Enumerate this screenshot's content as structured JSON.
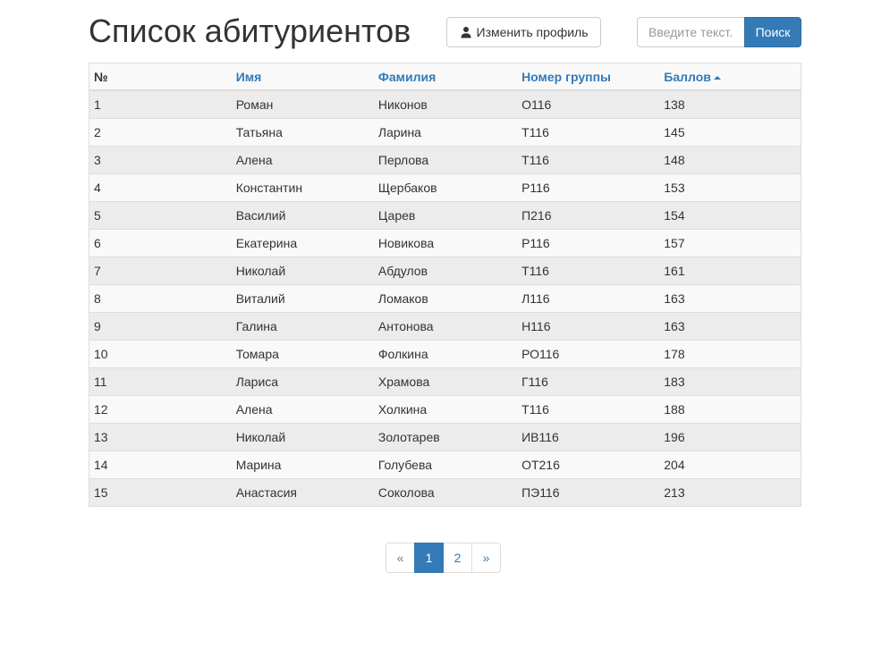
{
  "header": {
    "title": "Список абитуриентов",
    "profile_button_label": "Изменить профиль",
    "profile_icon": "user-icon",
    "search_placeholder": "Введите текст.",
    "search_value": "",
    "search_button_label": "Поиск"
  },
  "table": {
    "columns": {
      "num": "№",
      "name": "Имя",
      "surname": "Фамилия",
      "group": "Номер группы",
      "score": "Баллов"
    },
    "sort": {
      "column": "score",
      "direction": "asc",
      "icon": "sort-ascending-caret-icon"
    },
    "rows": [
      {
        "num": "1",
        "name": "Роман",
        "surname": "Никонов",
        "group": "О116",
        "score": "138"
      },
      {
        "num": "2",
        "name": "Татьяна",
        "surname": "Ларина",
        "group": "Т116",
        "score": "145"
      },
      {
        "num": "3",
        "name": "Алена",
        "surname": "Перлова",
        "group": "Т116",
        "score": "148"
      },
      {
        "num": "4",
        "name": "Константин",
        "surname": "Щербаков",
        "group": "Р116",
        "score": "153"
      },
      {
        "num": "5",
        "name": "Василий",
        "surname": "Царев",
        "group": "П216",
        "score": "154"
      },
      {
        "num": "6",
        "name": "Екатерина",
        "surname": "Новикова",
        "group": "Р116",
        "score": "157"
      },
      {
        "num": "7",
        "name": "Николай",
        "surname": "Абдулов",
        "group": "Т116",
        "score": "161"
      },
      {
        "num": "8",
        "name": "Виталий",
        "surname": "Ломаков",
        "group": "Л116",
        "score": "163"
      },
      {
        "num": "9",
        "name": "Галина",
        "surname": "Антонова",
        "group": "Н116",
        "score": "163"
      },
      {
        "num": "10",
        "name": "Томара",
        "surname": "Фолкина",
        "group": "РО116",
        "score": "178"
      },
      {
        "num": "11",
        "name": "Лариса",
        "surname": "Храмова",
        "group": "Г116",
        "score": "183"
      },
      {
        "num": "12",
        "name": "Алена",
        "surname": "Холкина",
        "group": "Т116",
        "score": "188"
      },
      {
        "num": "13",
        "name": "Николай",
        "surname": "Золотарев",
        "group": "ИВ116",
        "score": "196"
      },
      {
        "num": "14",
        "name": "Марина",
        "surname": "Голубева",
        "group": "ОТ216",
        "score": "204"
      },
      {
        "num": "15",
        "name": "Анастасия",
        "surname": "Соколова",
        "group": "ПЭ116",
        "score": "213"
      }
    ]
  },
  "pagination": {
    "prev_label": "«",
    "pages": [
      "1",
      "2"
    ],
    "current": "1",
    "next_label": "»"
  },
  "colors": {
    "primary": "#337ab7",
    "text": "#333333",
    "border": "#dddddd",
    "row_stripe": "#ececec",
    "row_alt": "#f9f9f9"
  }
}
